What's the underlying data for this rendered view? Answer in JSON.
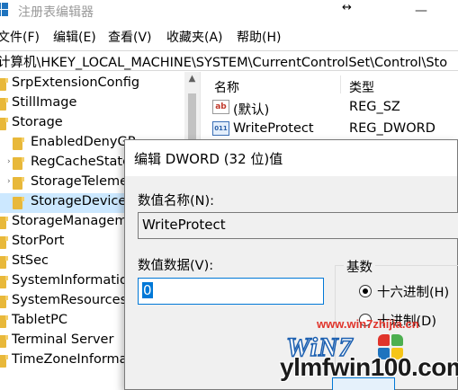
{
  "window": {
    "title": "注册表编辑器",
    "minimize_glyph": "—",
    "close_glyph": "✕",
    "cursor_glyph": "↔"
  },
  "menu": {
    "items": [
      "文件(F)",
      "编辑(E)",
      "查看(V)",
      "收藏夹(A)",
      "帮助(H)"
    ]
  },
  "address": {
    "path": "计算机\\HKEY_LOCAL_MACHINE\\SYSTEM\\CurrentControlSet\\Control\\Sto"
  },
  "tree": {
    "items": [
      {
        "label": "SrpExtensionConfig"
      },
      {
        "label": "StillImage"
      },
      {
        "label": "Storage"
      },
      {
        "label": "EnabledDenyGP"
      },
      {
        "label": "RegCacheState"
      },
      {
        "label": "StorageTelemetry"
      },
      {
        "label": "StorageDevicePolicies"
      },
      {
        "label": "StorageManagement"
      },
      {
        "label": "StorPort"
      },
      {
        "label": "StSec"
      },
      {
        "label": "SystemInformation"
      },
      {
        "label": "SystemResources"
      },
      {
        "label": "TabletPC"
      },
      {
        "label": "Terminal Server"
      },
      {
        "label": "TimeZoneInformation"
      }
    ],
    "expander_glyph": "›",
    "scroll_up_glyph": "▲"
  },
  "list": {
    "columns": {
      "name": "名称",
      "type": "类型"
    },
    "rows": [
      {
        "name": "(默认)",
        "type": "REG_SZ",
        "icon": "string-value-icon",
        "icon_text": "ab"
      },
      {
        "name": "WriteProtect",
        "type": "REG_DWORD",
        "icon": "dword-value-icon",
        "icon_text": "011"
      }
    ]
  },
  "dialog": {
    "title": "编辑 DWORD (32 位)值",
    "value_name_label": "数值名称(N):",
    "value_name": "WriteProtect",
    "value_data_label": "数值数据(V):",
    "value_data": "0",
    "base_label": "基数",
    "base_options": [
      {
        "label": "十六进制(H)",
        "selected": true
      },
      {
        "label": "十进制(D)",
        "selected": false
      }
    ]
  },
  "watermark": {
    "site1": "www.win7zhijia.cn",
    "brand": "WiN7",
    "site2": "ylmfwin100.com"
  },
  "colors": {
    "selection": "#cce8ff",
    "accent": "#0078d7",
    "folder": "#e8b83a",
    "watermark_red": "#e0342b"
  }
}
